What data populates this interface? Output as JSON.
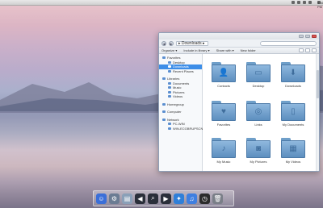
{
  "topbar": {
    "apple_glyph": "",
    "clock": "4:46 PM",
    "icons": [
      "wifi-icon",
      "volume-icon",
      "battery-icon",
      "user-icon"
    ]
  },
  "window": {
    "address": {
      "path": "▸ Downloads ▸",
      "back_glyph": "◀",
      "forward_glyph": "▶"
    },
    "toolbar": {
      "organize": "Organize ▾",
      "include": "Include in library ▾",
      "share": "Share with ▾",
      "new_folder": "New folder"
    },
    "sidebar": {
      "favorites": {
        "title": "Favorites",
        "items": [
          "Desktop",
          "Downloads",
          "Recent Places"
        ]
      },
      "libraries": {
        "title": "Libraries",
        "items": [
          "Documents",
          "Music",
          "Pictures",
          "Videos"
        ]
      },
      "homegroup": "Homegroup",
      "computer": "Computer",
      "network": {
        "title": "Network",
        "items": [
          "PC-WIN",
          "WIN-ECGBRUPSCN"
        ]
      }
    },
    "folders": [
      {
        "label": "Contacts",
        "glyph": "👤"
      },
      {
        "label": "Desktop",
        "glyph": "▭"
      },
      {
        "label": "Downloads",
        "glyph": "⬇"
      },
      {
        "label": "Favorites",
        "glyph": "♥"
      },
      {
        "label": "Links",
        "glyph": "◎"
      },
      {
        "label": "My Documents",
        "glyph": "▯"
      },
      {
        "label": "My Music",
        "glyph": "♪"
      },
      {
        "label": "My Pictures",
        "glyph": "◙"
      },
      {
        "label": "My Videos",
        "glyph": "▦"
      }
    ]
  },
  "dock": {
    "items": [
      {
        "name": "finder-icon",
        "color": "#3b6fd8",
        "glyph": "☺"
      },
      {
        "name": "appstore-icon",
        "color": "#6b7c93",
        "glyph": "⚙"
      },
      {
        "name": "explorer-icon",
        "color": "#8aa0b8",
        "glyph": "▤"
      },
      {
        "name": "back-arrow-icon",
        "color": "#2a2f3a",
        "glyph": "◀"
      },
      {
        "name": "search-icon",
        "color": "#2a2f3a",
        "glyph": "⌕"
      },
      {
        "name": "forward-arrow-icon",
        "color": "#2a2f3a",
        "glyph": "▶"
      },
      {
        "name": "safari-icon",
        "color": "#2f7fd8",
        "glyph": "✦"
      },
      {
        "name": "itunes-icon",
        "color": "#3f7fe0",
        "glyph": "♫"
      },
      {
        "name": "clock-icon",
        "color": "#2b2b2b",
        "glyph": "◷"
      },
      {
        "name": "trash-icon",
        "color": "#7a7f88",
        "glyph": "🗑"
      }
    ]
  }
}
